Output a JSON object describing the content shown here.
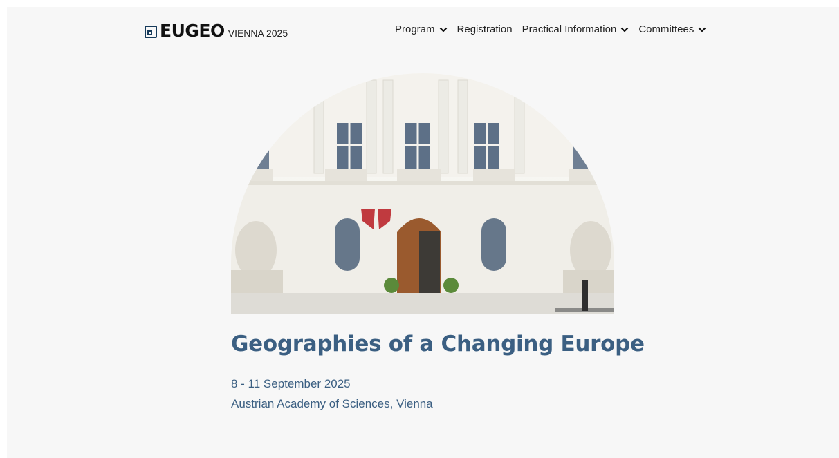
{
  "header": {
    "logo_word": "EUGEO",
    "logo_city": "VIENNA 2025",
    "nav": [
      {
        "label": "Program",
        "has_dropdown": true
      },
      {
        "label": "Registration",
        "has_dropdown": false
      },
      {
        "label": "Practical Information",
        "has_dropdown": true
      },
      {
        "label": "Committees",
        "has_dropdown": true
      }
    ]
  },
  "hero": {
    "title": "Geographies of a Changing Europe",
    "date": "8 - 11 September 2025",
    "venue": "Austrian Academy of Sciences, Vienna"
  },
  "colors": {
    "accent": "#3b5f82",
    "background": "#f7f7f7"
  }
}
